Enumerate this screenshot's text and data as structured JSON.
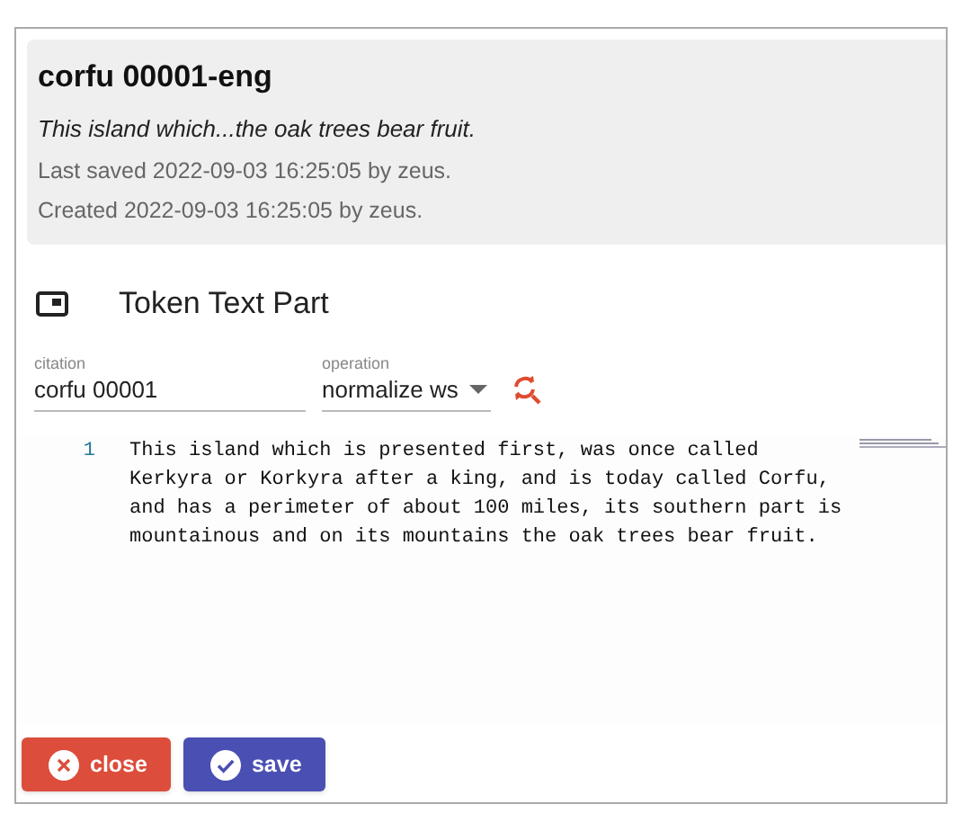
{
  "header": {
    "title": "corfu 00001-eng",
    "summary": "This island which...the oak trees bear fruit.",
    "last_saved": "Last saved 2022-09-03 16:25:05 by zeus.",
    "created": "Created 2022-09-03 16:25:05 by zeus."
  },
  "part": {
    "title": "Token Text Part"
  },
  "citation": {
    "label": "citation",
    "value": "corfu 00001"
  },
  "operation": {
    "label": "operation",
    "value": "normalize ws"
  },
  "editor": {
    "lines": [
      {
        "number": "1",
        "text": "This island which is presented first, was once called Kerkyra or Korkyra after a king, and is today called Corfu, and has a perimeter of about 100 miles, its southern part is mountainous and on its mountains the oak trees bear fruit."
      }
    ]
  },
  "buttons": [
    {
      "kind": "close",
      "label": "close"
    },
    {
      "kind": "save",
      "label": "save"
    }
  ]
}
